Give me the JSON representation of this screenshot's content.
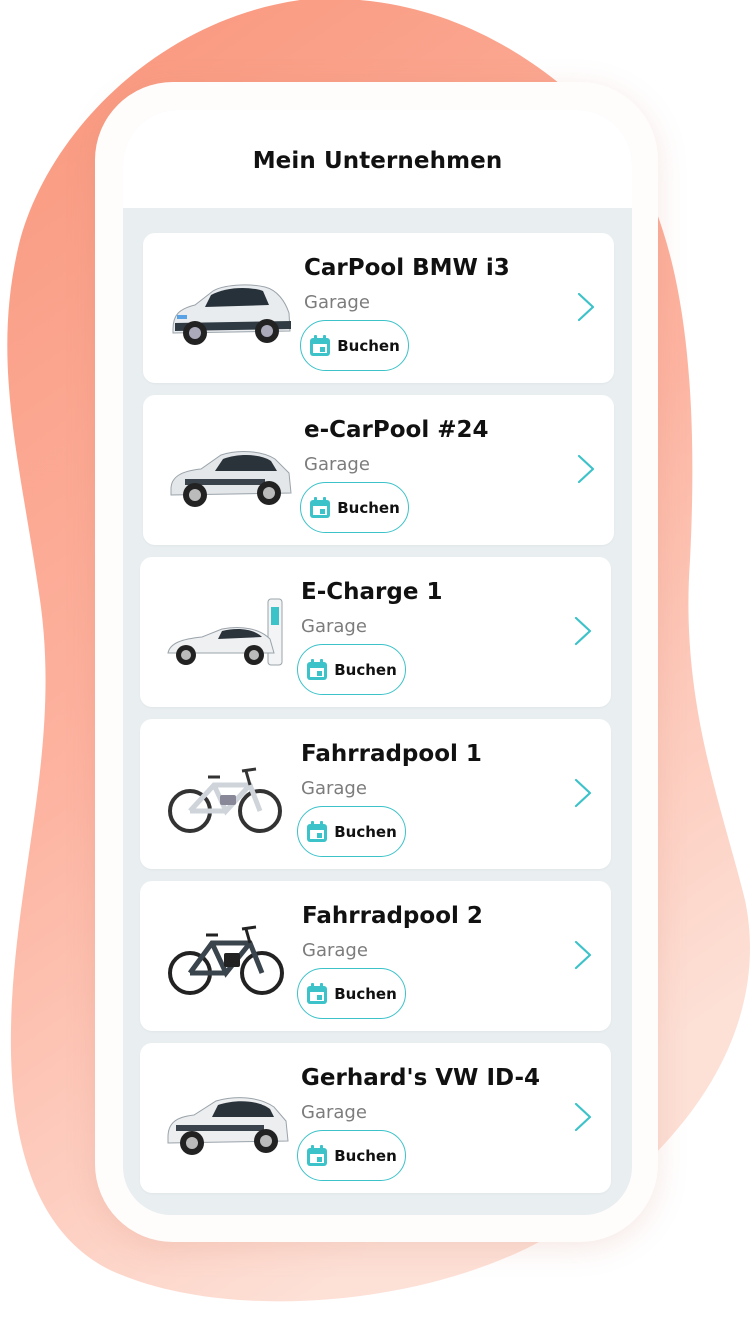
{
  "header": {
    "title": "Mein Unternehmen"
  },
  "theme": {
    "accent": "#3cc2c9",
    "blob": "#fba18a",
    "screen_bg": "#e9eff1"
  },
  "vehicles": [
    {
      "name": "CarPool BMW i3",
      "location": "Garage",
      "book_label": "Buchen",
      "image": "bmw-i3-car-icon"
    },
    {
      "name": "e-CarPool #24",
      "location": "Garage",
      "book_label": "Buchen",
      "image": "vw-id3-car-icon"
    },
    {
      "name": "E-Charge 1",
      "location": "Garage",
      "book_label": "Buchen",
      "image": "charging-station-car-icon"
    },
    {
      "name": "Fahrradpool 1",
      "location": "Garage",
      "book_label": "Buchen",
      "image": "e-bike-white-icon"
    },
    {
      "name": "Fahrradpool 2",
      "location": "Garage",
      "book_label": "Buchen",
      "image": "e-bike-dark-icon"
    },
    {
      "name": "Gerhard's VW ID-4",
      "location": "Garage",
      "book_label": "Buchen",
      "image": "vw-id4-suv-icon"
    }
  ]
}
